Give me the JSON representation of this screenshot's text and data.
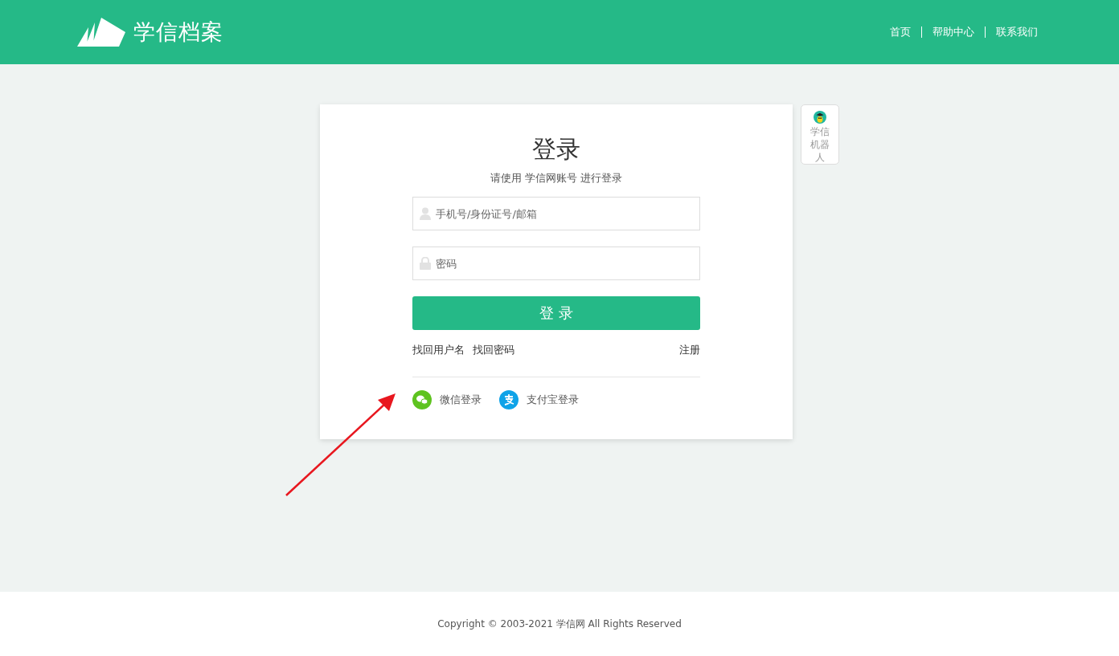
{
  "header": {
    "logo_text": "学信档案",
    "nav": [
      {
        "label": "首页"
      },
      {
        "label": "帮助中心"
      },
      {
        "label": "联系我们"
      }
    ]
  },
  "login": {
    "title": "登录",
    "subtitle": "请使用 学信网账号 进行登录",
    "username": {
      "placeholder": "手机号/身份证号/邮箱"
    },
    "password": {
      "placeholder": "密码"
    },
    "submit": "登 录",
    "links": [
      "找回用户名",
      "找回密码"
    ],
    "register": "注册",
    "social": [
      {
        "kind": "wechat",
        "label": "微信登录"
      },
      {
        "kind": "alipay",
        "label": "支付宝登录"
      }
    ]
  },
  "robot": {
    "label": "学信机器人"
  },
  "footer": {
    "copyright": "Copyright © 2003-2021 学信网 All Rights Reserved"
  }
}
